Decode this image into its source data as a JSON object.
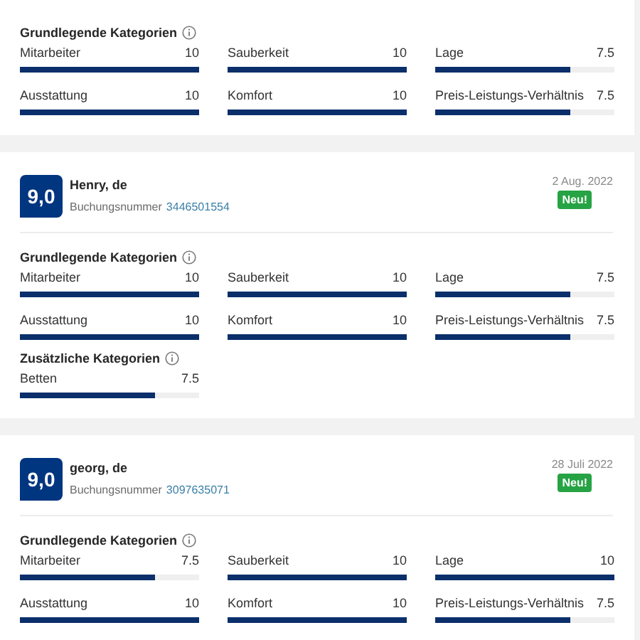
{
  "reviews": [
    {
      "groups": [
        {
          "title": "Grundlegende Kategorien",
          "items": [
            {
              "label": "Mitarbeiter",
              "value": "10",
              "level": 1
            },
            {
              "label": "Sauberkeit",
              "value": "10",
              "level": 1
            },
            {
              "label": "Lage",
              "value": "7.5",
              "level": 0.75
            },
            {
              "label": "Ausstattung",
              "value": "10",
              "level": 1
            },
            {
              "label": "Komfort",
              "value": "10",
              "level": 1
            },
            {
              "label": "Preis-Leistungs-Verhältnis",
              "value": "7.5",
              "level": 0.75
            }
          ]
        }
      ]
    },
    {
      "header": {
        "score": "9,0",
        "name": "Henry, de",
        "booking_label": "Buchungsnummer",
        "booking_number": "3446501554",
        "date": "2 Aug. 2022",
        "badge": "Neu!"
      },
      "groups": [
        {
          "title": "Grundlegende Kategorien",
          "items": [
            {
              "label": "Mitarbeiter",
              "value": "10",
              "level": 1
            },
            {
              "label": "Sauberkeit",
              "value": "10",
              "level": 1
            },
            {
              "label": "Lage",
              "value": "7.5",
              "level": 0.75
            },
            {
              "label": "Ausstattung",
              "value": "10",
              "level": 1
            },
            {
              "label": "Komfort",
              "value": "10",
              "level": 1
            },
            {
              "label": "Preis-Leistungs-Verhältnis",
              "value": "7.5",
              "level": 0.75
            }
          ]
        },
        {
          "title": "Zusätzliche Kategorien",
          "items": [
            {
              "label": "Betten",
              "value": "7.5",
              "level": 0.75
            }
          ]
        }
      ]
    },
    {
      "header": {
        "score": "9,0",
        "name": "georg, de",
        "booking_label": "Buchungsnummer",
        "booking_number": "3097635071",
        "date": "28 Juli 2022",
        "badge": "Neu!"
      },
      "groups": [
        {
          "title": "Grundlegende Kategorien",
          "items": [
            {
              "label": "Mitarbeiter",
              "value": "7.5",
              "level": 0.75
            },
            {
              "label": "Sauberkeit",
              "value": "10",
              "level": 1
            },
            {
              "label": "Lage",
              "value": "10",
              "level": 1
            },
            {
              "label": "Ausstattung",
              "value": "10",
              "level": 1
            },
            {
              "label": "Komfort",
              "value": "10",
              "level": 1
            },
            {
              "label": "Preis-Leistungs-Verhältnis",
              "value": "7.5",
              "level": 0.75
            }
          ]
        }
      ]
    }
  ]
}
